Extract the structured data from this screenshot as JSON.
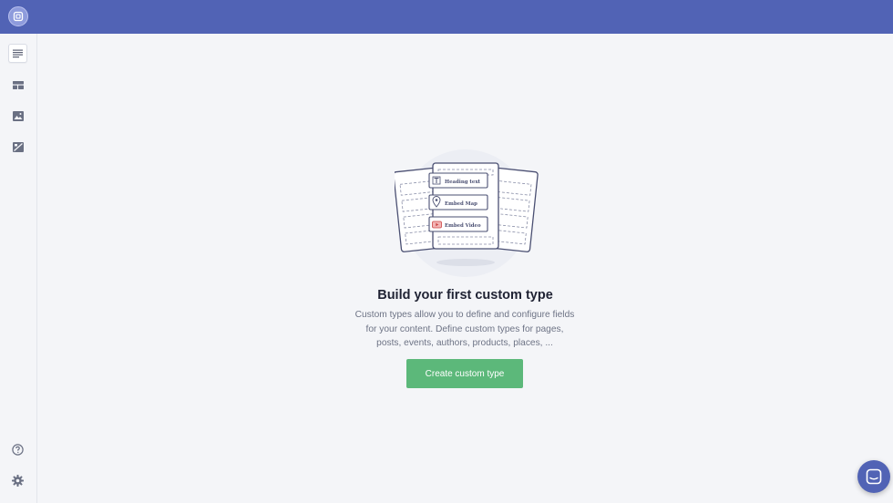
{
  "empty_state": {
    "title": "Build your first custom type",
    "description_lines": [
      "Custom types allow you to define and configure fields",
      "for your content. Define custom types for pages,",
      "posts, events, authors, products, places, ..."
    ],
    "cta_label": "Create custom type"
  },
  "illustration": {
    "field_1": "Heading text",
    "field_2": "Embed Map",
    "field_3": "Embed Video"
  },
  "colors": {
    "header": "#5163b5",
    "primary_button": "#5cb87a",
    "background": "#f4f5f8"
  },
  "sidebar": {
    "items": [
      {
        "icon": "custom-types-icon",
        "active": true
      },
      {
        "icon": "slices-icon",
        "active": false
      },
      {
        "icon": "image-icon",
        "active": false
      },
      {
        "icon": "image-gallery-icon",
        "active": false
      },
      {
        "icon": "help-icon",
        "active": false
      },
      {
        "icon": "settings-icon",
        "active": false
      }
    ]
  }
}
